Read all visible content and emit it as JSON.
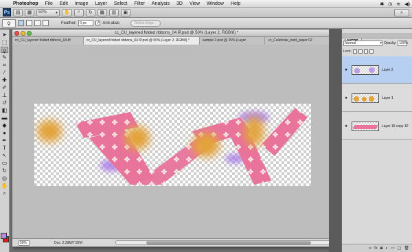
{
  "menubar": {
    "apple": "",
    "items": [
      "Photoshop",
      "File",
      "Edit",
      "Image",
      "Layer",
      "Select",
      "Filter",
      "Analysis",
      "3D",
      "View",
      "Window",
      "Help"
    ]
  },
  "appbar": {
    "logo": "Ps",
    "zoom": "50%"
  },
  "options": {
    "feather_label": "Feather:",
    "feather_value": "0 px",
    "antialias_label": "Anti-alias",
    "antialias_checked": "✓",
    "refine_label": "Refine Edge..."
  },
  "document": {
    "title": "cc_CU_layered folded ribbons_04 lP.psd @ 50% (Layer 2, RGB/8) *",
    "tabs": [
      "cc_CU_layered folded ribbons_04.tif",
      "cc_CU_layered folded ribbons_04 lP.psd @ 50% (Layer 2, RGB/8) *",
      "sample 2.psd @ 25% (Layer",
      "cc_Celebrate_bold_paper 02"
    ],
    "status_zoom": "50%",
    "status_doc": "Doc: 2.39M/7.82M"
  },
  "layers_panel": {
    "tab_label": "LAYERS",
    "blend_mode": "Normal",
    "opacity_label": "Opacity:",
    "opacity_value": "100%",
    "lock_label": "Lock:",
    "layers": [
      {
        "name": "Layer 2"
      },
      {
        "name": "Layer 1"
      },
      {
        "name": "Layer 15 copy 10"
      }
    ],
    "footer_icons": [
      "link-icon",
      "fx-icon",
      "mask-icon",
      "adjustment-icon",
      "group-icon",
      "new-layer-icon",
      "trash-icon"
    ]
  },
  "colors": {
    "foreground": "#b888d8",
    "background": "#e81818",
    "ribbon": "#e8739b",
    "spot": "#e3a33a",
    "selected_layer": "#b7cff0"
  }
}
